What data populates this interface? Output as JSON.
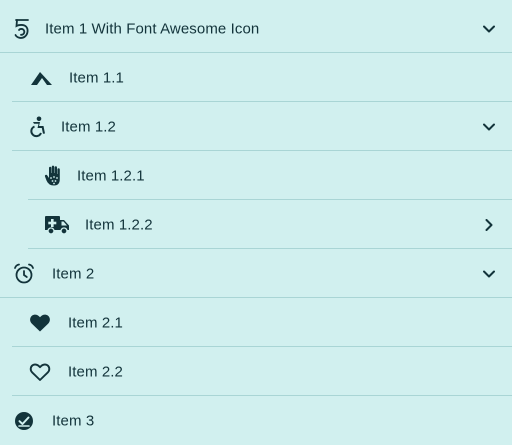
{
  "menu": {
    "items": [
      {
        "label": "Item 1 With Font Awesome Icon",
        "icon": "fingerprint-5-icon",
        "expand": "chevron-down-icon"
      },
      {
        "label": "Item 1.1",
        "icon": "pyramid-mountain-icon"
      },
      {
        "label": "Item 1.2",
        "icon": "accessible-wheelchair-icon",
        "expand": "chevron-down-icon"
      },
      {
        "label": "Item 1.2.1",
        "icon": "hand-dots-icon"
      },
      {
        "label": "Item 1.2.2",
        "icon": "ambulance-icon",
        "expand": "chevron-right-icon"
      },
      {
        "label": "Item 2",
        "icon": "alarm-clock-icon",
        "expand": "chevron-down-icon"
      },
      {
        "label": "Item 2.1",
        "icon": "heart-solid-icon"
      },
      {
        "label": "Item 2.2",
        "icon": "heart-outline-icon"
      },
      {
        "label": "Item 3",
        "icon": "circle-check-icon"
      }
    ]
  },
  "colors": {
    "background": "#d1f0ef",
    "text": "#13343b",
    "separator": "#a9d5d5"
  }
}
